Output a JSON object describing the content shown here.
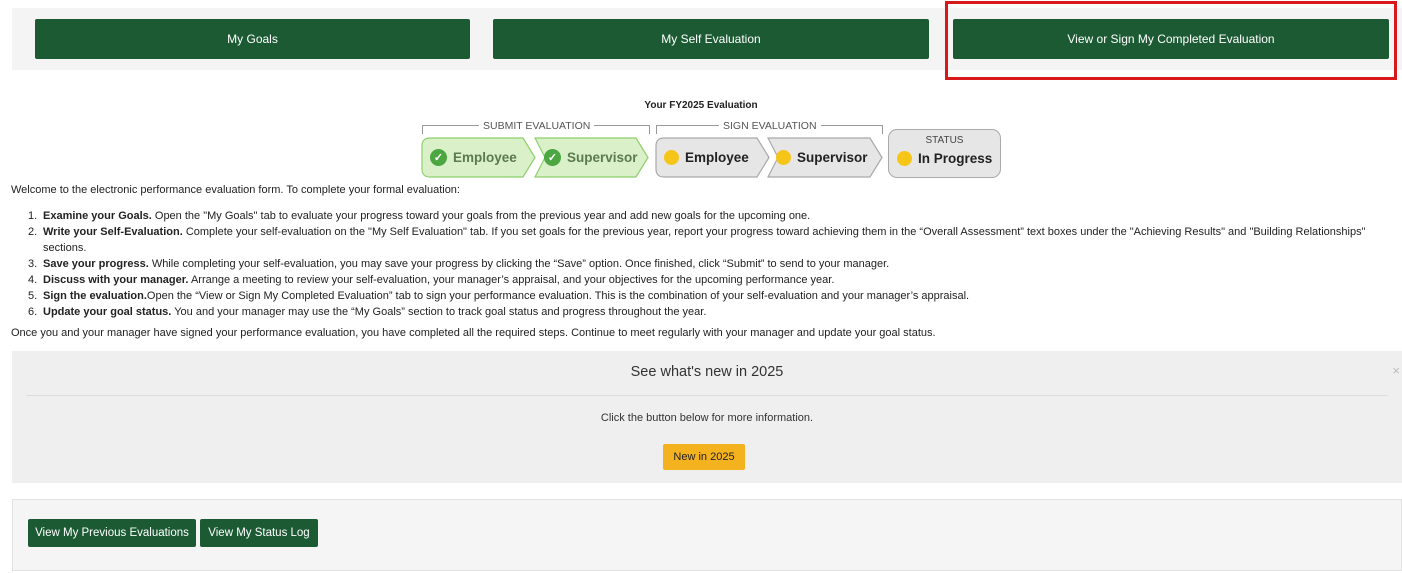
{
  "tabs": {
    "my_goals": "My Goals",
    "my_self_evaluation": "My Self Evaluation",
    "view_sign": "View or Sign My Completed Evaluation"
  },
  "tracker": {
    "title": "Your FY2025 Evaluation",
    "submit_group": "SUBMIT EVALUATION",
    "sign_group": "SIGN EVALUATION",
    "submit_employee": "Employee",
    "submit_supervisor": "Supervisor",
    "sign_employee": "Employee",
    "sign_supervisor": "Supervisor",
    "status_label": "STATUS",
    "status_value": "In Progress",
    "colors": {
      "done_fill": "#d9f0c8",
      "done_border": "#8fcf6c",
      "done_icon": "#4ca743",
      "pending_fill": "#e6e6e6",
      "pending_border": "#a9a9a9",
      "pending_dot": "#f5c518"
    }
  },
  "instructions": {
    "intro": "Welcome to the electronic performance evaluation form. To complete your formal evaluation:",
    "steps": [
      {
        "num": "1.",
        "bold": "Examine your Goals.",
        "text": " Open the \"My Goals\" tab to evaluate your progress toward your goals from the previous year and add new goals for the upcoming one."
      },
      {
        "num": "2.",
        "bold": "Write your Self-Evaluation.",
        "text": " Complete your self-evaluation on the \"My Self Evaluation\" tab. If you set goals for the previous year, report your progress toward achieving them in the “Overall Assessment” text boxes under the \"Achieving Results\" and \"Building Relationships\" sections."
      },
      {
        "num": "3.",
        "bold": "Save your progress.",
        "text": " While completing your self-evaluation, you may save your progress by clicking the “Save” option. Once finished, click “Submit” to send to your manager."
      },
      {
        "num": "4.",
        "bold": "Discuss with your manager.",
        "text": " Arrange a meeting to review your self-evaluation, your manager’s appraisal, and your objectives for the upcoming performance year."
      },
      {
        "num": "5.",
        "bold": "Sign the evaluation.",
        "text": "Open the “View or Sign My Completed Evaluation” tab to sign your performance evaluation. This is the combination of your self-evaluation and your manager’s appraisal."
      },
      {
        "num": "6.",
        "bold": "Update your goal status.",
        "text": " You and your manager may use the “My Goals” section to track goal status and progress throughout the year."
      }
    ],
    "outro": "Once you and your manager have signed your performance evaluation, you have completed all the required steps. Continue to meet regularly with your manager and update your goal status."
  },
  "announcement": {
    "title": "See what's new in 2025",
    "close": "×",
    "body": "Click the button below for more information.",
    "button": "New in 2025"
  },
  "bottom": {
    "previous_evaluations": "View My Previous Evaluations",
    "status_log": "View My Status Log"
  },
  "colors": {
    "brand_green": "#1c5a34",
    "accent_yellow": "#f5b21f",
    "highlight_red": "#d7191c"
  }
}
